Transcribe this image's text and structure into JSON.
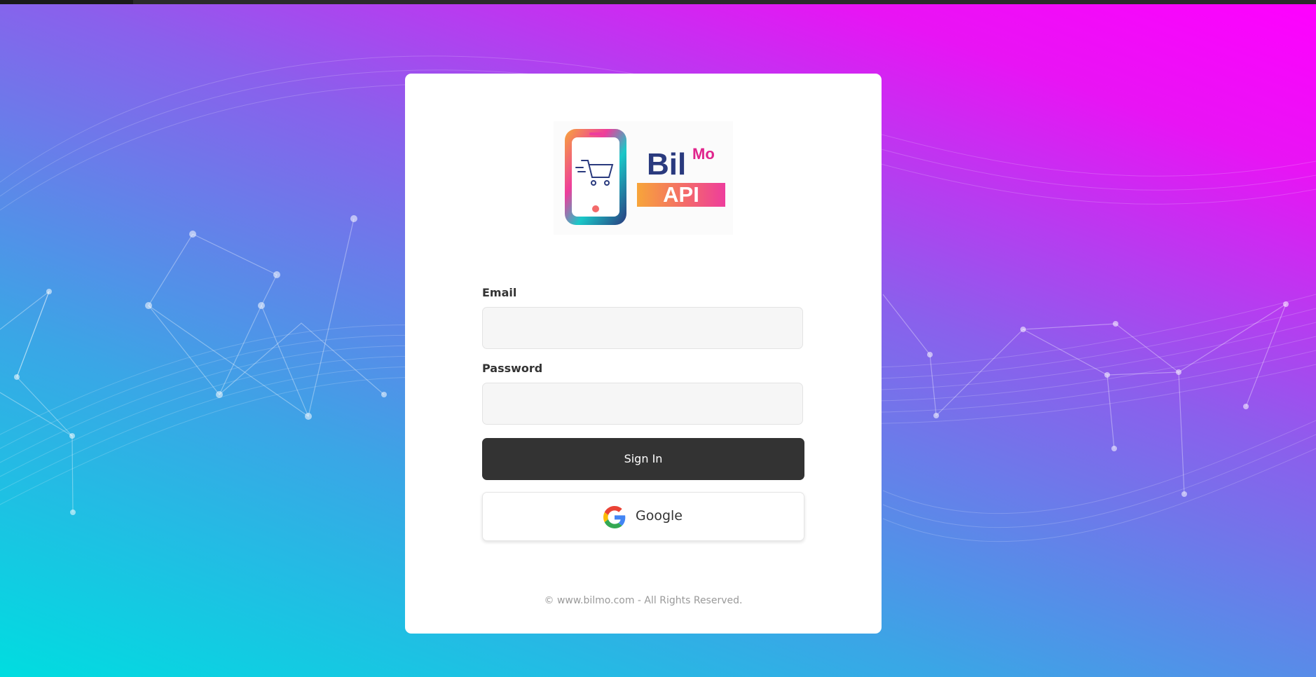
{
  "logo": {
    "brand_main": "Bil",
    "brand_super": "Mo",
    "brand_badge": "API",
    "icon": "phone-cart-icon"
  },
  "form": {
    "email_label": "Email",
    "email_value": "",
    "email_placeholder": "",
    "password_label": "Password",
    "password_value": "",
    "password_placeholder": "",
    "signin_label": "Sign In",
    "google_label": "Google",
    "google_icon": "google-g-icon"
  },
  "footer": {
    "text": "© www.bilmo.com - All Rights Reserved."
  },
  "colors": {
    "bg_gradient_start": "#00dde0",
    "bg_gradient_end": "#ff00ff",
    "card": "#ffffff",
    "primary_button": "#333333",
    "brand_navy": "#2a3a7e",
    "brand_pink": "#e0248c",
    "badge_orange": "#f7a53a"
  }
}
